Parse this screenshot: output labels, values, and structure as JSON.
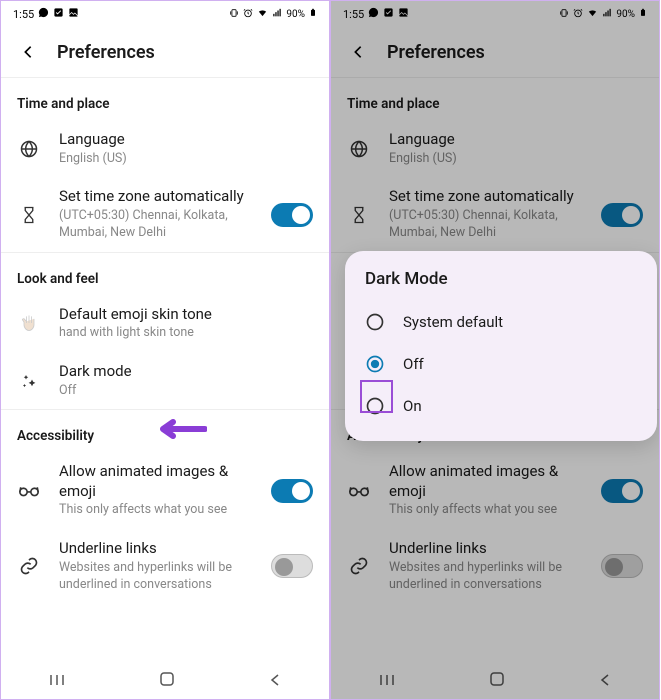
{
  "status": {
    "time": "1:55",
    "battery_pct": "90%"
  },
  "header": {
    "title": "Preferences"
  },
  "sections": {
    "time_place": {
      "title": "Time and place",
      "language": {
        "title": "Language",
        "value": "English (US)"
      },
      "timezone": {
        "title": "Set time zone automatically",
        "value": "(UTC+05:30) Chennai, Kolkata, Mumbai, New Delhi"
      }
    },
    "look_feel": {
      "title": "Look and feel",
      "emoji_tone": {
        "title": "Default emoji skin tone",
        "value": "hand with light skin tone"
      },
      "dark_mode": {
        "title": "Dark mode",
        "value": "Off"
      }
    },
    "accessibility": {
      "title": "Accessibility",
      "animated": {
        "title": "Allow animated images & emoji",
        "value": "This only affects what you see"
      },
      "underline": {
        "title": "Underline links",
        "value": "Websites and hyperlinks will be underlined in conversations"
      }
    }
  },
  "dialog": {
    "title": "Dark Mode",
    "options": [
      "System default",
      "Off",
      "On"
    ],
    "selected": "Off"
  }
}
